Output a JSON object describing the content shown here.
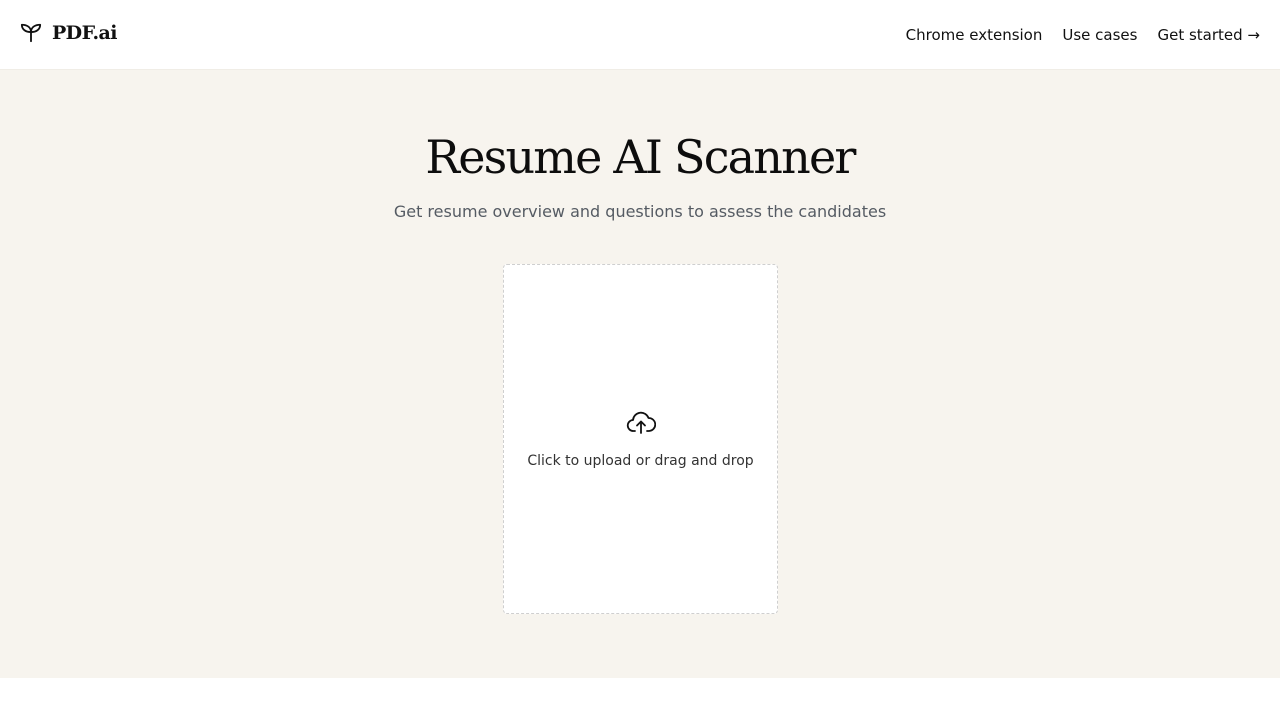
{
  "header": {
    "logo_text": "PDF.ai",
    "logo_icon": "sprout-icon",
    "nav": {
      "chrome_extension": "Chrome extension",
      "use_cases": "Use cases",
      "get_started": "Get started →"
    }
  },
  "hero": {
    "title": "Resume AI Scanner",
    "subtitle": "Get resume overview and questions to assess the candidates",
    "upload": {
      "icon": "cloud-upload-icon",
      "label": "Click to upload or drag and drop"
    }
  },
  "colors": {
    "hero_background": "#f7f4ee",
    "text_primary": "#111111",
    "text_muted": "#555b63",
    "dropzone_border": "#cfcfcf"
  }
}
